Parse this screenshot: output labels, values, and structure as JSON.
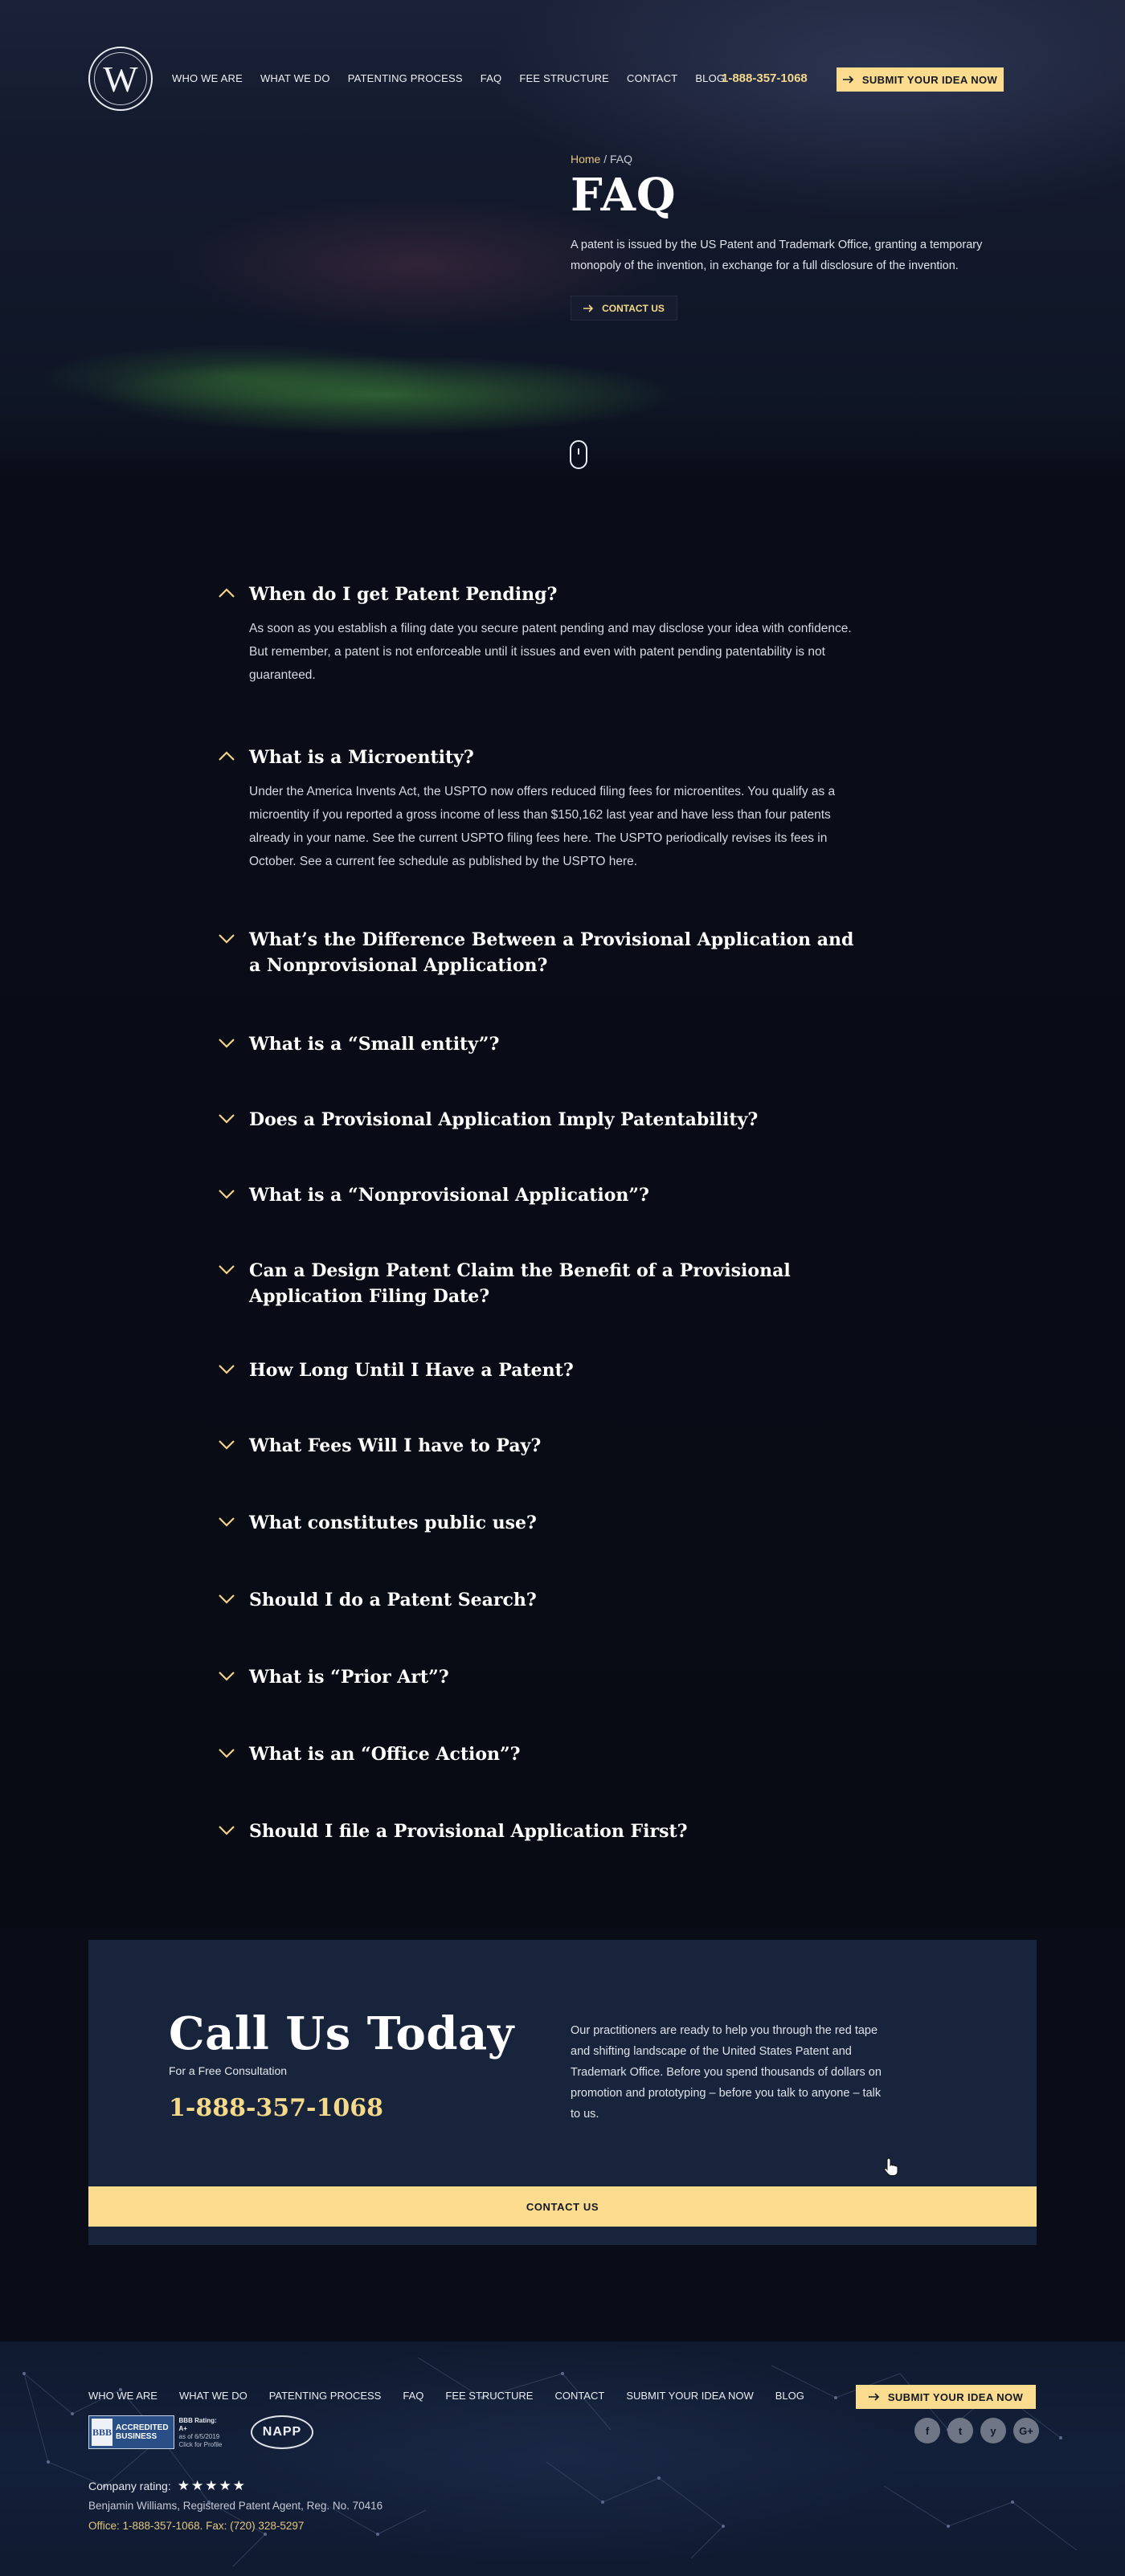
{
  "brand": {
    "monogram": "W",
    "logo_name": "Benjamin Williams logo"
  },
  "nav": {
    "items": [
      "WHO WE ARE",
      "WHAT WE DO",
      "PATENTING PROCESS",
      "FAQ",
      "FEE STRUCTURE",
      "CONTACT",
      "BLOG"
    ]
  },
  "header": {
    "phone": "1-888-357-1068",
    "submit_label": "SUBMIT YOUR IDEA NOW"
  },
  "hero": {
    "breadcrumb_home": "Home",
    "breadcrumb_sep": " / ",
    "breadcrumb_current": "FAQ",
    "title": "FAQ",
    "description": "A patent is issued by the US Patent and Trademark Office, granting a temporary monopoly of the invention, in exchange for a full disclosure of the invention.",
    "contact_label": "CONTACT US"
  },
  "faq": {
    "items": [
      {
        "question": "When do I get Patent Pending?",
        "expanded": true,
        "answer": "As soon as you establish a filing date you secure patent pending and may disclose your idea with confidence. But remember, a patent is not enforceable until it issues and even with patent pending patentability is not guaranteed."
      },
      {
        "question": "What is a Microentity?",
        "expanded": true,
        "answer": "Under the America Invents Act, the USPTO now offers reduced filing fees for microentites. You qualify as a microentity if you reported a gross income of less than $150,162 last year and have less than four patents already in your name. See the current USPTO filing fees here. The USPTO periodically revises its fees in October. See a current fee schedule as published by the USPTO here."
      },
      {
        "question": "What’s the Difference Between a Provisional Application and a Nonprovisional Application?",
        "expanded": false
      },
      {
        "question": "What is a “Small entity”?",
        "expanded": false
      },
      {
        "question": "Does a Provisional Application Imply Patentability?",
        "expanded": false
      },
      {
        "question": "What is a “Nonprovisional Application”?",
        "expanded": false
      },
      {
        "question": "Can a Design Patent Claim the Benefit of a Provisional Application Filing Date?",
        "expanded": false
      },
      {
        "question": "How Long Until I Have a Patent?",
        "expanded": false
      },
      {
        "question": "What Fees Will I have to Pay?",
        "expanded": false
      },
      {
        "question": "What constitutes public use?",
        "expanded": false
      },
      {
        "question": "Should I do a Patent Search?",
        "expanded": false
      },
      {
        "question": "What is “Prior Art”?",
        "expanded": false
      },
      {
        "question": "What is an “Office Action”?",
        "expanded": false
      },
      {
        "question": "Should I file a Provisional Application First?",
        "expanded": false
      }
    ]
  },
  "cta": {
    "title": "Call Us Today",
    "subtitle": "For a Free Consultation",
    "phone": "1-888-357-1068",
    "text": "Our practitioners are ready to help you through the red tape and shifting landscape of the United States Patent and Trademark Office. Before you spend thousands of dollars on promotion and prototyping – before you talk to anyone – talk to us.",
    "button_label": "CONTACT US"
  },
  "footer": {
    "nav": [
      "WHO WE ARE",
      "WHAT WE DO",
      "PATENTING PROCESS",
      "FAQ",
      "FEE STRUCTURE",
      "CONTACT",
      "SUBMIT YOUR IDEA NOW",
      "BLOG"
    ],
    "submit_label": "SUBMIT YOUR IDEA NOW",
    "bbb": {
      "mark": "BBB",
      "seal_line1": "ACCREDITED",
      "seal_line2": "BUSINESS",
      "rating": "BBB Rating: A+",
      "as_of": "as of 6/5/2019",
      "profile": "Click for Profile"
    },
    "napp": "NAPP",
    "socials": [
      {
        "icon": "facebook-icon",
        "glyph": "f"
      },
      {
        "icon": "twitter-icon",
        "glyph": "t"
      },
      {
        "icon": "yelp-icon",
        "glyph": "y"
      },
      {
        "icon": "google-plus-icon",
        "glyph": "G+"
      }
    ],
    "rating_label": "Company rating:",
    "rating_value": 5,
    "stars": "★★★★★",
    "agent": "Benjamin Williams, Registered Patent Agent, Reg. No. 70416",
    "office": "Office: 1-888-357-1068. Fax: (720) 328-5297"
  },
  "colors": {
    "accent": "#fbdc8e",
    "accent_text": "#f5d98a",
    "background": "#0a0d18",
    "cta_panel": "#17243b"
  }
}
